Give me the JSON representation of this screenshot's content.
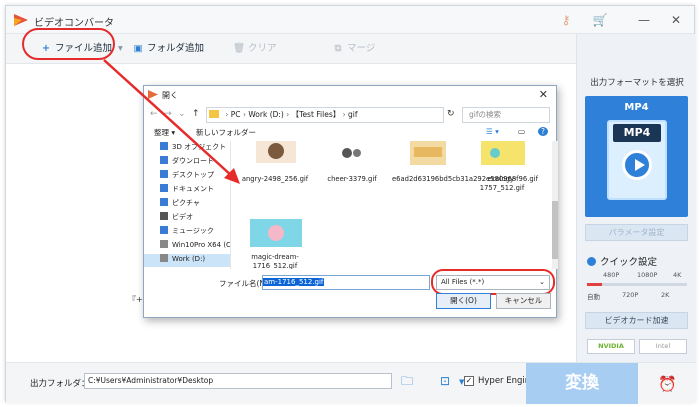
{
  "app": {
    "title": "ビデオコンバータ"
  },
  "toolbar": {
    "add_file": "ファイル追加",
    "add_folder": "フォルダ追加",
    "clear": "クリア",
    "merge": "マージ"
  },
  "center": {
    "hint": "『+』"
  },
  "right": {
    "format_title": "出力フォーマットを選択",
    "format_name": "MP4",
    "format_label": "MP4",
    "param_btn": "パラメータ設定",
    "quick_label": "クイック設定",
    "ticks_top": [
      "480P",
      "1080P",
      "4K"
    ],
    "ticks_bottom": [
      "自動",
      "720P",
      "2K"
    ],
    "slider_fraction": 0.15,
    "gpu_btn": "ビデオカード加速",
    "badge_nvidia": "NVIDIA",
    "badge_intel": "Intel"
  },
  "bottom": {
    "output_label": "出力フォルダ：",
    "output_path": "C:¥Users¥Administrator¥Desktop",
    "hyper_label": "Hyper Engine",
    "convert": "変換"
  },
  "dialog": {
    "title": "開く",
    "path": [
      "PC",
      "Work (D:)",
      "【Test Files】",
      "gif"
    ],
    "search_placeholder": "gifの検索",
    "organize": "整理",
    "new_folder": "新しいフォルダー",
    "nav_items": [
      "3D オブジェクト",
      "ダウンロード",
      "デスクトップ",
      "ドキュメント",
      "ピクチャ",
      "ビデオ",
      "ミュージック",
      "Win10Pro X64 (C",
      "Work (D:)"
    ],
    "files": [
      {
        "name": "angry-2498_256.gif"
      },
      {
        "name": "cheer-3379.gif"
      },
      {
        "name": "e6ad2d63196bd5cb31a292e580968f96.gif"
      },
      {
        "name": "ecology-1757_512.gif"
      },
      {
        "name": "magic-dream-1716_512.gif"
      }
    ],
    "filename_label": "ファイル名(N):",
    "filename_value": "am-1716_512.gif",
    "filetype": "All Files (*.*)",
    "open_btn": "開く(O)",
    "cancel_btn": "キャンセル"
  },
  "colors": {
    "accent": "#2f80d8",
    "highlight": "#e62b2b",
    "convert": "#a8cdf3"
  }
}
